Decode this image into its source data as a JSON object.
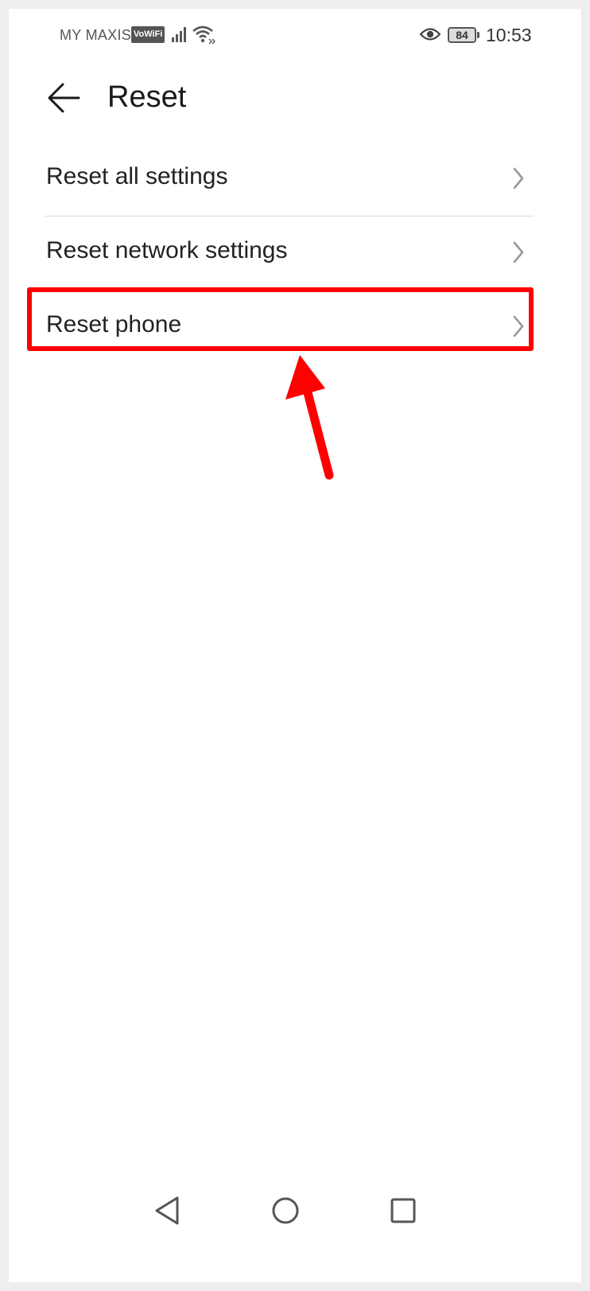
{
  "status_bar": {
    "carrier": "MY MAXIS",
    "vowifi": "VoWiFi",
    "battery": "84",
    "time": "10:53",
    "icons": [
      "signal-icon",
      "wifi-icon",
      "eye-icon",
      "battery-icon"
    ]
  },
  "header": {
    "title": "Reset"
  },
  "menu": {
    "items": [
      {
        "label": "Reset all settings"
      },
      {
        "label": "Reset network settings"
      },
      {
        "label": "Reset phone"
      }
    ]
  },
  "annotation": {
    "highlight_color": "#ff0000",
    "highlighted_item": "Reset phone"
  },
  "nav_bar": {
    "icons": [
      "back-triangle-icon",
      "home-circle-icon",
      "recents-square-icon"
    ]
  }
}
